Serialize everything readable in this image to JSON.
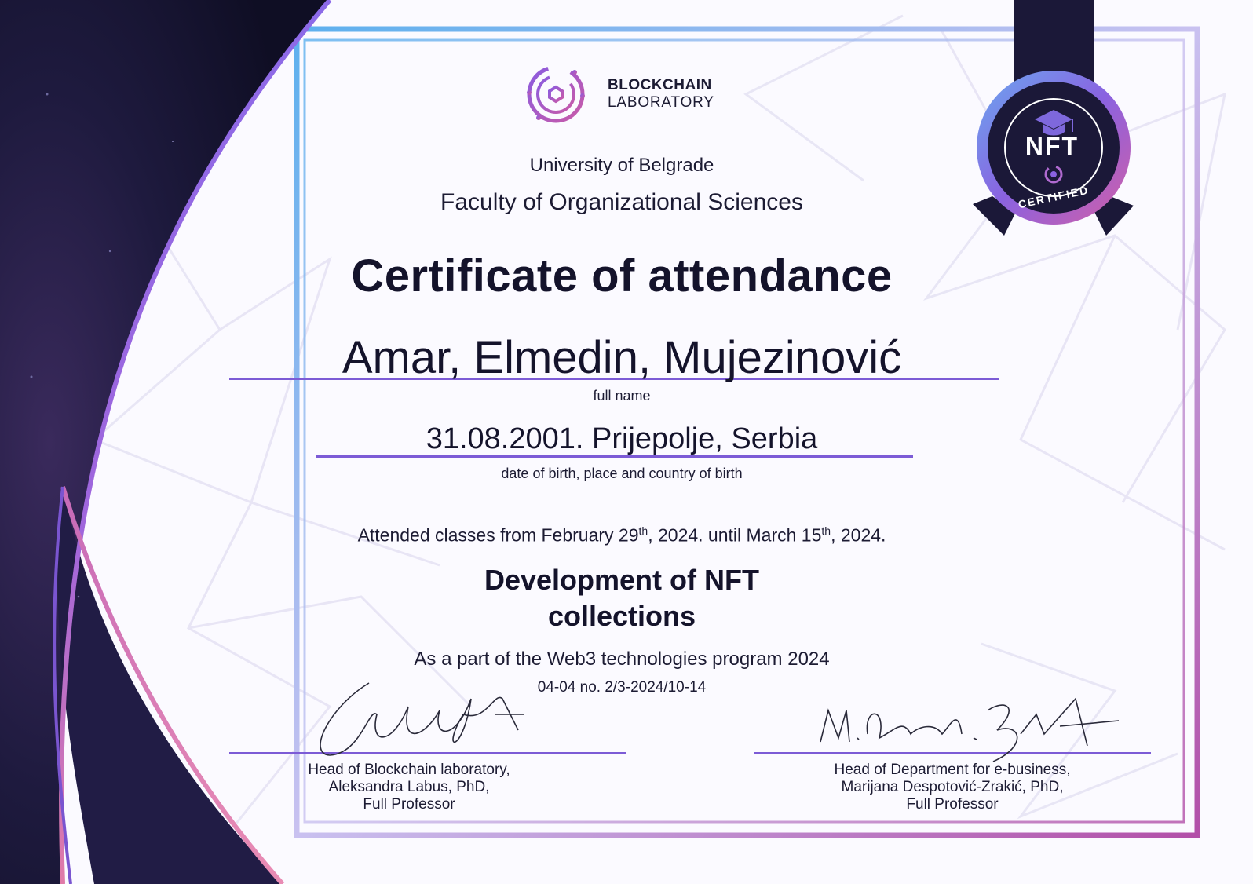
{
  "logo": {
    "line1": "BLOCKCHAIN",
    "line2": "LABORATORY"
  },
  "university": "University of Belgrade",
  "faculty": "Faculty of Organizational Sciences",
  "title": "Certificate of attendance",
  "recipient": {
    "full_name": "Amar, Elmedin, Mujezinović",
    "full_name_caption": "full name"
  },
  "birth": {
    "value": "31.08.2001. Prijepolje, Serbia",
    "caption": "date of birth, place and country of birth"
  },
  "attendance": {
    "prefix": "Attended classes from February 29",
    "sup1": "th",
    "middle": ", 2024. until March 15",
    "sup2": "th",
    "suffix": ", 2024."
  },
  "course": {
    "line1": "Development of NFT",
    "line2": "collections"
  },
  "program": "As a part of the Web3 technologies program 2024",
  "reference_no": "04-04 no. 2/3-2024/10-14",
  "signatories": [
    {
      "role": "Head of Blockchain laboratory,",
      "name": "Aleksandra Labus, PhD,",
      "title": "Full Professor"
    },
    {
      "role": "Head of Department for e-business,",
      "name": "Marijana Despotović-Zrakić, PhD,",
      "title": "Full Professor"
    }
  ],
  "badge": {
    "main": "NFT",
    "sub": "CERTIFIED"
  },
  "colors": {
    "accent": "#7c5bd6",
    "dark": "#14132b",
    "pink": "#d0609a",
    "navy": "#1b1838"
  }
}
